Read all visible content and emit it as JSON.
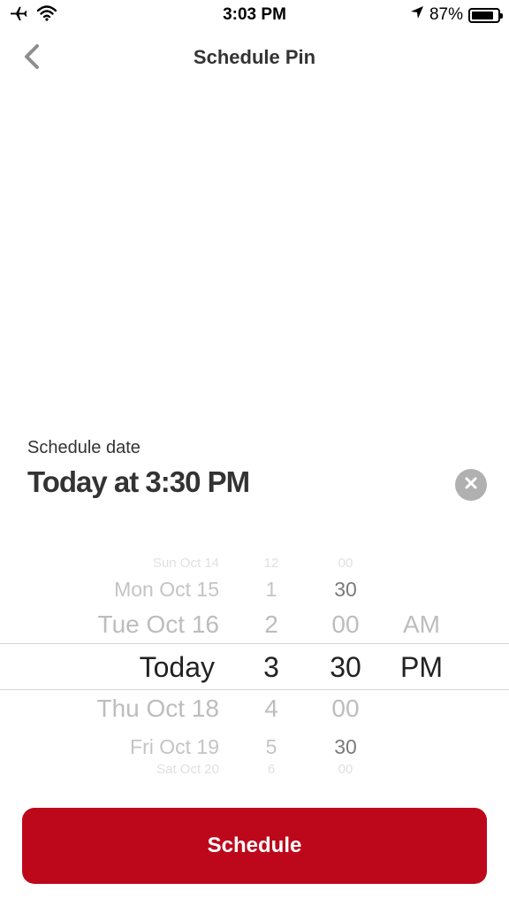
{
  "status_bar": {
    "time": "3:03 PM",
    "battery": "87%",
    "battery_level": 0.87,
    "icons": [
      "airplane-icon",
      "wifi-icon",
      "location-arrow-icon",
      "battery-icon"
    ]
  },
  "header": {
    "title": "Schedule Pin",
    "back_icon": "chevron-left-icon"
  },
  "schedule": {
    "label": "Schedule date",
    "value": "Today at 3:30 PM",
    "clear_icon": "clear-icon"
  },
  "picker": {
    "days": [
      "Sun Oct 14",
      "Mon Oct 15",
      "Tue Oct 16",
      "Today",
      "Thu Oct 18",
      "Fri Oct 19",
      "Sat Oct 20"
    ],
    "hours": [
      "12",
      "1",
      "2",
      "3",
      "4",
      "5",
      "6"
    ],
    "minutes": [
      "00",
      "30",
      "00",
      "30",
      "00",
      "30",
      "00"
    ],
    "periods": [
      "AM",
      "PM"
    ],
    "selected": {
      "day": "Today",
      "hour": "3",
      "minute": "30",
      "period": "PM"
    }
  },
  "actions": {
    "schedule_label": "Schedule"
  },
  "colors": {
    "accent": "#bd081c",
    "clear_button": "#b0b0b0",
    "text": "#333333"
  }
}
